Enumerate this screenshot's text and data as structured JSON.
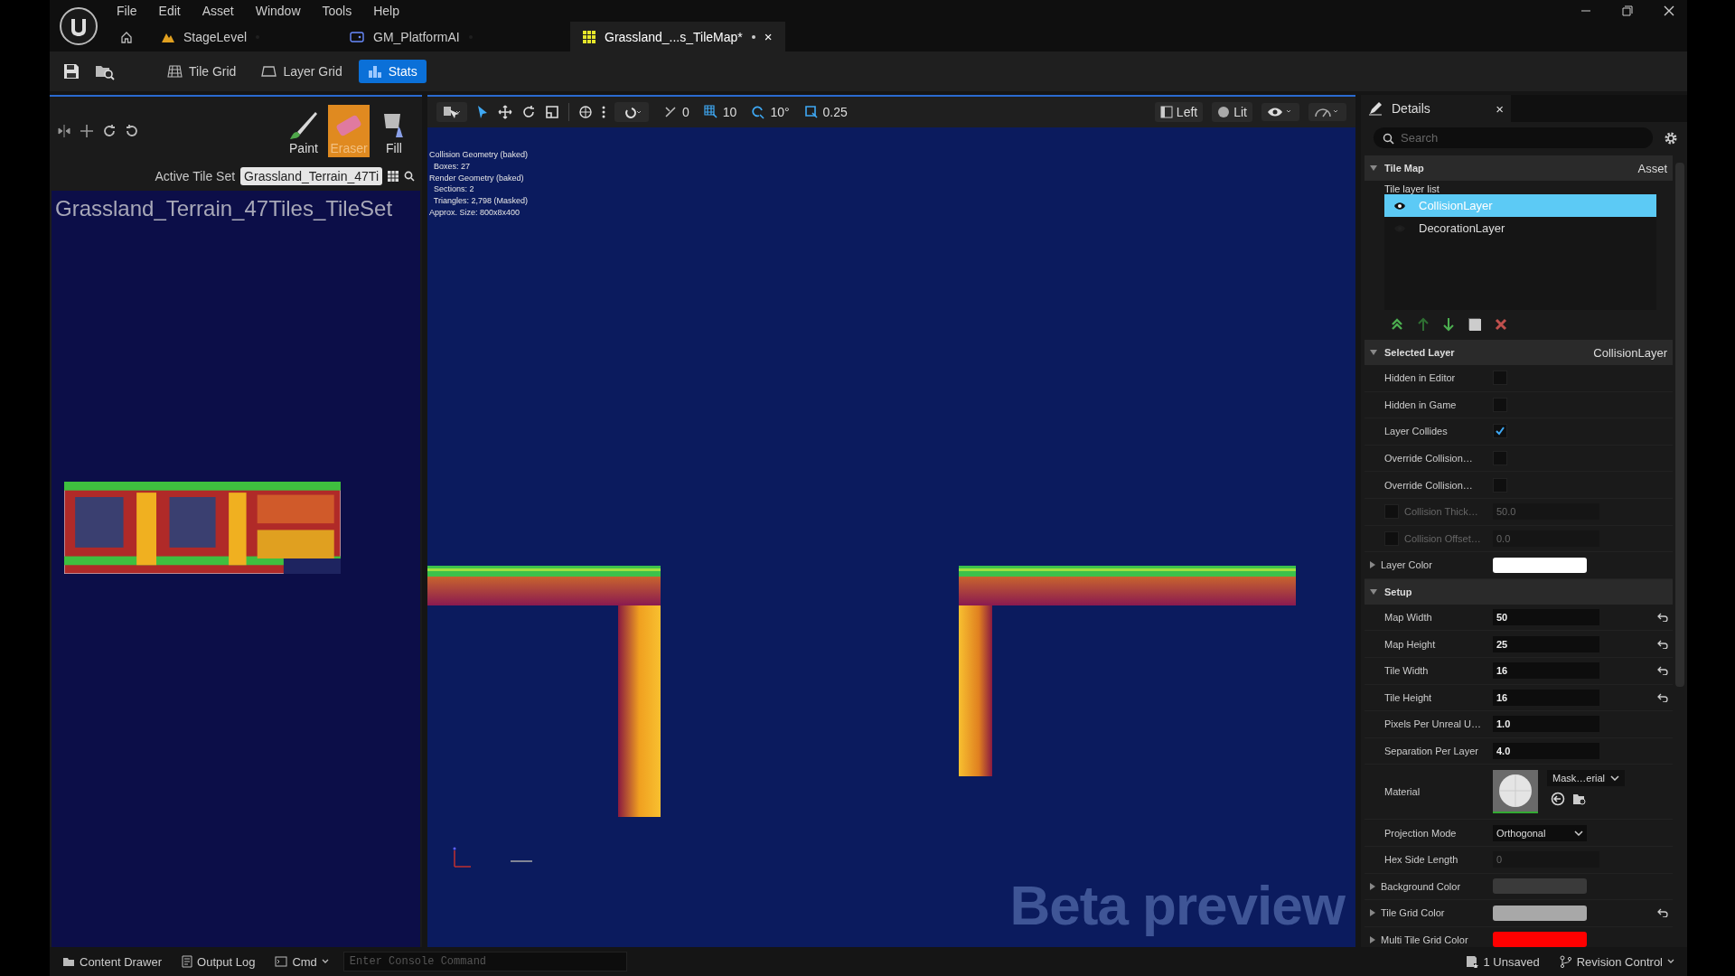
{
  "title_bar": {
    "menu": [
      "File",
      "Edit",
      "Asset",
      "Window",
      "Tools",
      "Help"
    ],
    "tabs": [
      {
        "label": "StageLevel",
        "kind": "level",
        "selected": false,
        "modified": false
      },
      {
        "label": "GM_PlatformAI",
        "kind": "blueprint",
        "selected": false,
        "modified": false
      },
      {
        "label": "Grassland_...s_TileMap*",
        "kind": "tilemap",
        "selected": true,
        "modified": true,
        "close": "×"
      }
    ]
  },
  "toolbar": {
    "buttons": [
      {
        "label": "Tile Grid",
        "kind": "grid",
        "selected": false
      },
      {
        "label": "Layer Grid",
        "kind": "layer",
        "selected": false
      },
      {
        "label": "Stats",
        "kind": "stats",
        "selected": true
      }
    ]
  },
  "tile_set_panel": {
    "tools": [
      {
        "label": "Paint",
        "kind": "paint",
        "selected": false
      },
      {
        "label": "Eraser",
        "kind": "eraser",
        "selected": true
      },
      {
        "label": "Fill",
        "kind": "fill",
        "selected": false
      }
    ],
    "active_tile_set_label": "Active Tile Set",
    "active_tile_set": "Grassland_Terrain_47Ti",
    "tile_set_title": "Grassland_Terrain_47Tiles_TileSet"
  },
  "viewport": {
    "toolbar": {
      "rotation_snap": "0",
      "grid_snap": "10",
      "angle_snap": "10°",
      "scale_snap": "0.25",
      "view": "Left",
      "view_mode": "Lit"
    },
    "stats": [
      "Collision Geometry (baked)",
      "  Boxes: 27",
      "Render Geometry (baked)",
      "  Sections: 2",
      "  Triangles: 2,798 (Masked)",
      "Approx. Size: 800x8x400"
    ],
    "watermark": "Beta preview"
  },
  "details": {
    "title": "Details",
    "close": "×",
    "search": {
      "placeholder": "Search"
    },
    "sections": [
      {
        "title": "Tile Map",
        "value": "Asset",
        "expanded": true,
        "kind": "layers",
        "list_label": "Tile layer list",
        "layers": [
          {
            "name": "CollisionLayer",
            "visible": true,
            "selected": true
          },
          {
            "name": "DecorationLayer",
            "visible": false,
            "selected": false
          }
        ]
      },
      {
        "title": "Selected Layer",
        "value": "CollisionLayer",
        "expanded": true,
        "kind": "properties",
        "properties": [
          {
            "label": "Hidden in Editor",
            "kind": "checkbox",
            "checked": false
          },
          {
            "label": "Hidden in Game",
            "kind": "checkbox",
            "checked": false
          },
          {
            "label": "Layer Collides",
            "kind": "checkbox",
            "checked": true
          },
          {
            "label": "Override Collision…",
            "kind": "checkbox",
            "checked": false
          },
          {
            "label": "Override Collision…",
            "kind": "checkbox",
            "checked": false
          },
          {
            "label": "Collision Thick…",
            "kind": "toggled",
            "checked": false,
            "value": "50.0"
          },
          {
            "label": "Collision Offset…",
            "kind": "toggled",
            "checked": false,
            "value": "0.0"
          },
          {
            "label": "Layer Color",
            "kind": "color",
            "color": "#ffffff",
            "expanded": false,
            "reset": false
          }
        ]
      },
      {
        "title": "Setup",
        "expanded": true,
        "kind": "properties",
        "properties": [
          {
            "label": "Map Width",
            "kind": "number",
            "value": "50",
            "disabled": false,
            "reset": true
          },
          {
            "label": "Map Height",
            "kind": "number",
            "value": "25",
            "disabled": false,
            "reset": true
          },
          {
            "label": "Tile Width",
            "kind": "number",
            "value": "16",
            "disabled": false,
            "reset": true
          },
          {
            "label": "Tile Height",
            "kind": "number",
            "value": "16",
            "disabled": false,
            "reset": true
          },
          {
            "label": "Pixels Per Unreal U…",
            "kind": "number",
            "value": "1.0",
            "disabled": false,
            "reset": false
          },
          {
            "label": "Separation Per Layer",
            "kind": "number",
            "value": "4.0",
            "disabled": false,
            "reset": false
          },
          {
            "label": "Material",
            "kind": "material",
            "value": "Mask…erial"
          },
          {
            "label": "Projection Mode",
            "kind": "dropdown",
            "value": "Orthogonal"
          },
          {
            "label": "Hex Side Length",
            "kind": "number",
            "value": "0",
            "disabled": true,
            "reset": false
          },
          {
            "label": "Background Color",
            "kind": "color",
            "color": "#3a3a3a",
            "expanded": false,
            "reset": false
          },
          {
            "label": "Tile Grid Color",
            "kind": "color",
            "color": "#a8a8a8",
            "expanded": false,
            "reset": true
          },
          {
            "label": "Multi Tile Grid Color",
            "kind": "color",
            "color": "#ff0000",
            "expanded": false,
            "reset": false
          }
        ]
      }
    ]
  },
  "status_bar": {
    "content_drawer": "Content Drawer",
    "output_log": "Output Log",
    "cmd": "Cmd",
    "console": {
      "placeholder": "Enter Console Command"
    },
    "unsaved": "1 Unsaved",
    "revision_control": "Revision Control"
  }
}
